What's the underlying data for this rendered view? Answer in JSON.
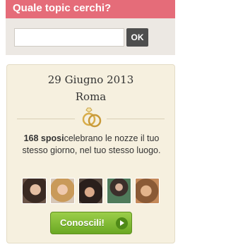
{
  "search": {
    "title": "Quale topic cerchi?",
    "input_value": "",
    "ok_label": "OK"
  },
  "wedding": {
    "date": "29 Giugno 2013",
    "city": "Roma",
    "count": "168 sposi",
    "text": "celebrano le nozze il tuo stesso giorno, nel tuo stesso luogo.",
    "cta_label": "Conoscili!"
  },
  "colors": {
    "header": "#e56c79",
    "panel": "#f6f0df",
    "cta": "#7cb932"
  },
  "icons": [
    "rings-icon",
    "arrow-right-icon"
  ]
}
